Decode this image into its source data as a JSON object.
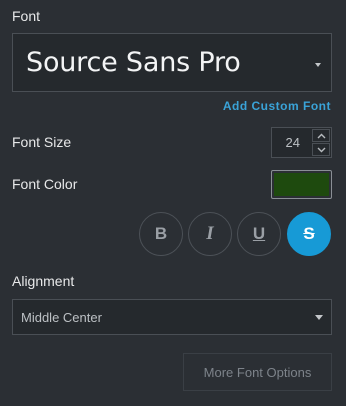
{
  "font": {
    "label": "Font",
    "selected": "Source Sans Pro",
    "add_custom_font": "Add Custom Font"
  },
  "font_size": {
    "label": "Font Size",
    "value": "24"
  },
  "font_color": {
    "label": "Font Color",
    "value": "#1e4a0e"
  },
  "style_buttons": [
    {
      "name": "bold",
      "glyph": "B",
      "active": false
    },
    {
      "name": "italic",
      "glyph": "I",
      "active": false
    },
    {
      "name": "underline",
      "glyph": "U",
      "active": false
    },
    {
      "name": "strikethrough",
      "glyph": "S",
      "active": true
    }
  ],
  "alignment": {
    "label": "Alignment",
    "selected": "Middle Center"
  },
  "more_options": {
    "label": "More Font Options"
  },
  "colors": {
    "accent": "#179ad6",
    "link": "#3aa3d8",
    "background": "#2b2f34"
  }
}
